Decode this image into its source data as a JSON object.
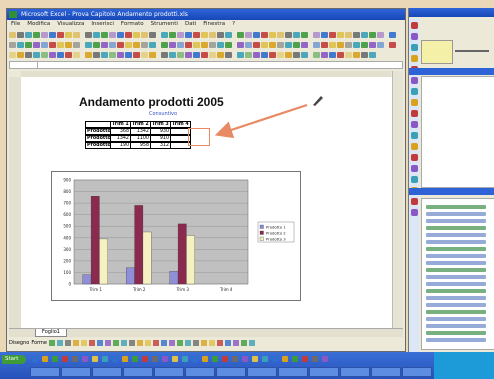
{
  "window": {
    "title": "Microsoft Excel - Prova Capitolo Andamento prodotti.xls",
    "menu": [
      "File",
      "Modifica",
      "Visualizza",
      "Inserisci",
      "Formato",
      "Strumenti",
      "Dati",
      "Finestra",
      "?"
    ]
  },
  "sheet": {
    "title": "Andamento prodotti 2005",
    "subtitle": "Consuntivo",
    "table": {
      "headers": [
        "",
        "Trim 1",
        "Trim 2",
        "Trim 3",
        "Trim 4"
      ],
      "rows": [
        [
          "Prodotto 1",
          "368",
          "1342",
          "930",
          ""
        ],
        [
          "Prodotto 2",
          "1342",
          "1100",
          "910",
          ""
        ],
        [
          "Prodotto 3",
          "190",
          "958",
          "312",
          ""
        ]
      ]
    },
    "tab_label": "Foglio1"
  },
  "chart_data": {
    "type": "bar",
    "categories": [
      "Trim 1",
      "Trim 2",
      "Trim 3",
      "Trim 4"
    ],
    "ylim": [
      0,
      900
    ],
    "yticks": [
      0,
      100,
      200,
      300,
      400,
      500,
      600,
      700,
      800,
      900
    ],
    "series": [
      {
        "name": "Prodotto 1",
        "color": "#8f8fd8",
        "values": [
          80,
          140,
          110,
          0
        ]
      },
      {
        "name": "Prodotto 2",
        "color": "#8b2a4f",
        "values": [
          760,
          680,
          520,
          0
        ]
      },
      {
        "name": "Prodotto 3",
        "color": "#f6f1c0",
        "values": [
          390,
          450,
          420,
          0
        ]
      }
    ],
    "legend": "right",
    "grid": true
  },
  "draw_toolbar": {
    "draw_label": "Disegno",
    "autoshapes_label": "Forme"
  },
  "taskbar": {
    "start_label": "Start"
  },
  "colors": {
    "arrow": "#e88a64",
    "highlight_box": "#e88a64",
    "plot_area": "#c0c0c0"
  }
}
